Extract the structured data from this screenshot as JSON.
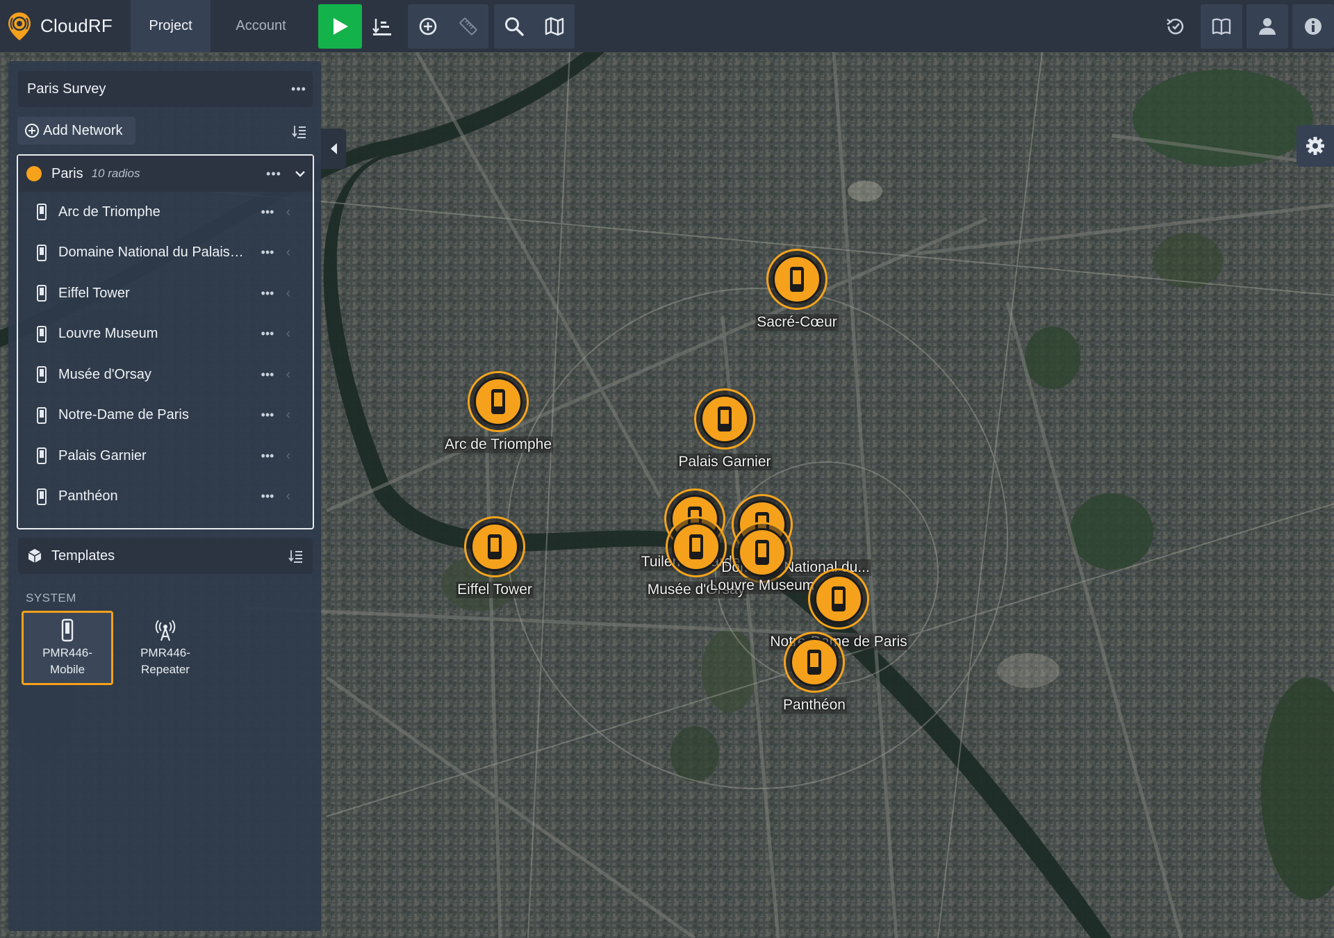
{
  "app": {
    "name": "CloudRF"
  },
  "nav": {
    "tabs": [
      {
        "label": "Project"
      },
      {
        "label": "Account"
      }
    ]
  },
  "project": {
    "name": "Paris Survey",
    "add_network_label": "Add Network"
  },
  "network": {
    "name": "Paris",
    "count_label": "10 radios",
    "color": "#f7a21b",
    "radios": [
      {
        "name": "Arc de Triomphe"
      },
      {
        "name": "Domaine National du Palais…"
      },
      {
        "name": "Eiffel Tower"
      },
      {
        "name": "Louvre Museum"
      },
      {
        "name": "Musée d'Orsay"
      },
      {
        "name": "Notre-Dame de Paris"
      },
      {
        "name": "Palais Garnier"
      },
      {
        "name": "Panthéon"
      }
    ]
  },
  "templates": {
    "title": "Templates",
    "section": "SYSTEM",
    "items": [
      {
        "line1": "PMR446-",
        "line2": "Mobile",
        "icon": "phone-icon"
      },
      {
        "line1": "PMR446-",
        "line2": "Repeater",
        "icon": "antenna-icon"
      }
    ]
  },
  "map": {
    "markers": [
      {
        "label": "Sacré-Cœur"
      },
      {
        "label": "Arc de Triomphe"
      },
      {
        "label": "Palais Garnier"
      },
      {
        "label": "Tuileries Garden"
      },
      {
        "label": "Domaine National du..."
      },
      {
        "label": "Musée d'Orsay"
      },
      {
        "label": "Louvre Museum"
      },
      {
        "label": "Eiffel Tower"
      },
      {
        "label": "Notre-Dame de Paris"
      },
      {
        "label": "Panthéon"
      }
    ]
  },
  "colors": {
    "accent": "#f5a11b",
    "run": "#13b24b",
    "topbar": "#2c3442"
  }
}
